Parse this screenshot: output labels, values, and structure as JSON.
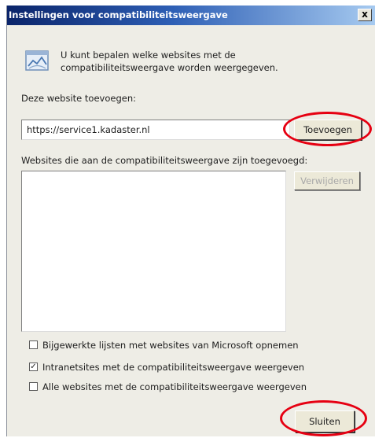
{
  "dialog": {
    "title": "Instellingen voor compatibiliteitsweergave",
    "close_label": "x",
    "info_text": "U kunt bepalen welke websites met de compatibiliteitsweergave worden weergegeven.",
    "add_label": "Deze website toevoegen:",
    "url_value": "https://service1.kadaster.nl",
    "add_button": "Toevoegen",
    "list_label": "Websites die aan de compatibiliteitsweergave zijn toegevoegd:",
    "remove_button": "Verwijderen",
    "checkboxes": [
      {
        "label": "Bijgewerkte lijsten met websites van Microsoft opnemen",
        "checked": false
      },
      {
        "label": "Intranetsites met de compatibiliteitsweergave weergeven",
        "checked": true
      },
      {
        "label": "Alle websites met de compatibiliteitsweergave weergeven",
        "checked": false
      }
    ],
    "close_button": "Sluiten"
  },
  "check_mark": "✓",
  "colors": {
    "title_gradient_start": "#0a246a",
    "title_gradient_end": "#a6caf0",
    "dialog_background": "#eeede6",
    "annotation_red": "#e60012"
  }
}
